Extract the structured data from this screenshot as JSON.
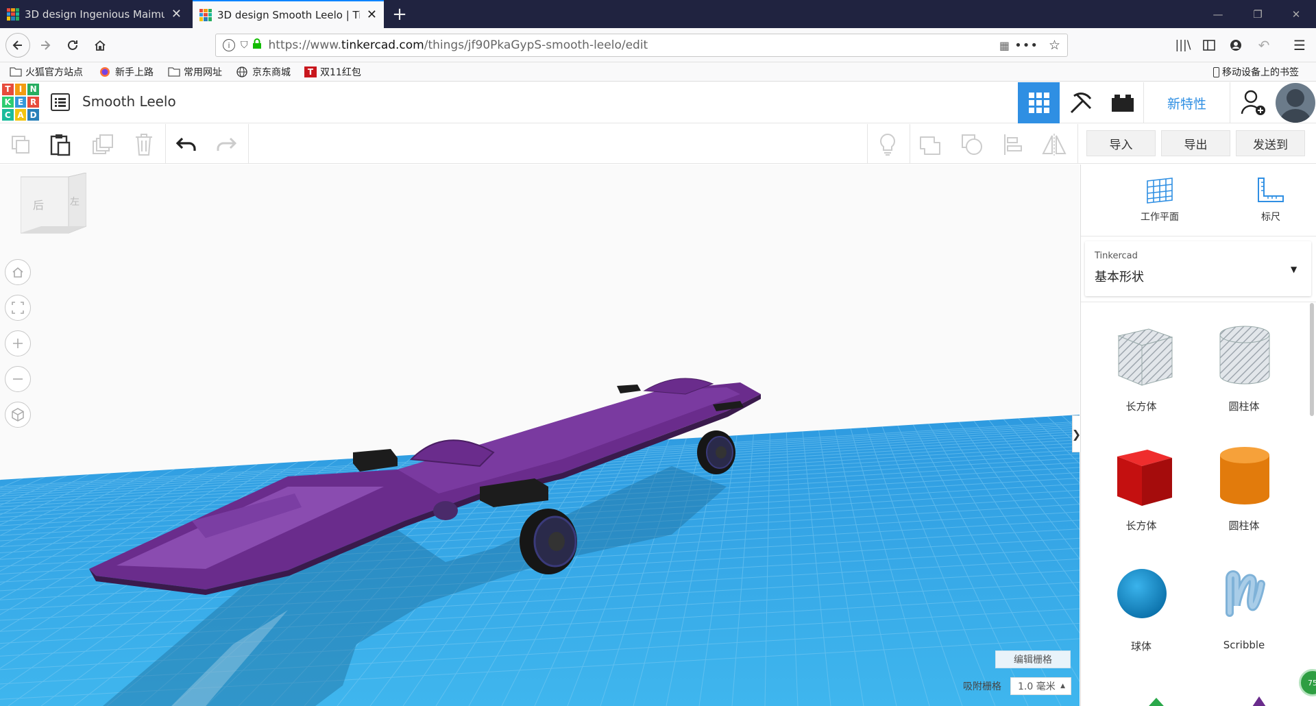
{
  "browser": {
    "tabs": [
      {
        "title": "3D design Ingenious Maimu",
        "active": false
      },
      {
        "title": "3D design Smooth Leelo | Ti",
        "active": true
      }
    ],
    "new_tab_icon": "plus-icon",
    "url_prefix": "https://www.",
    "url_domain": "tinkercad.com",
    "url_path": "/things/jf90PkaGypS-smooth-leelo/edit",
    "bookmarks": [
      {
        "label": "火狐官方站点",
        "icon": "folder-icon"
      },
      {
        "label": "新手上路",
        "icon": "firefox-icon"
      },
      {
        "label": "常用网址",
        "icon": "folder-icon"
      },
      {
        "label": "京东商城",
        "icon": "globe-icon"
      },
      {
        "label": "双11红包",
        "icon": "t-icon"
      }
    ],
    "mobile_bookmarks": "移动设备上的书签"
  },
  "app": {
    "logo_letters": [
      "T",
      "I",
      "N",
      "K",
      "E",
      "R",
      "C",
      "A",
      "D"
    ],
    "logo_colors": [
      "#e74c3c",
      "#f39c12",
      "#27ae60",
      "#2ecc71",
      "#3498db",
      "#e74c3c",
      "#1abc9c",
      "#f1c40f",
      "#2980b9"
    ],
    "project_title": "Smooth Leelo",
    "whats_new": "新特性",
    "accent": "#2f8fe3"
  },
  "toolbar": {
    "import": "导入",
    "export": "导出",
    "send_to": "发送到"
  },
  "viewcube": {
    "back": "后",
    "left": "左"
  },
  "grid": {
    "edit_grid": "编辑栅格",
    "snap_label": "吸附栅格",
    "snap_value": "1.0 毫米"
  },
  "panel": {
    "workplane": "工作平面",
    "ruler": "标尺",
    "library_source": "Tinkercad",
    "library_name": "基本形状",
    "shapes": [
      {
        "label": "长方体",
        "kind": "box-hole"
      },
      {
        "label": "圆柱体",
        "kind": "cylinder-hole"
      },
      {
        "label": "长方体",
        "kind": "box"
      },
      {
        "label": "圆柱体",
        "kind": "cylinder"
      },
      {
        "label": "球体",
        "kind": "sphere"
      },
      {
        "label": "Scribble",
        "kind": "scribble"
      }
    ],
    "badge": "75"
  }
}
